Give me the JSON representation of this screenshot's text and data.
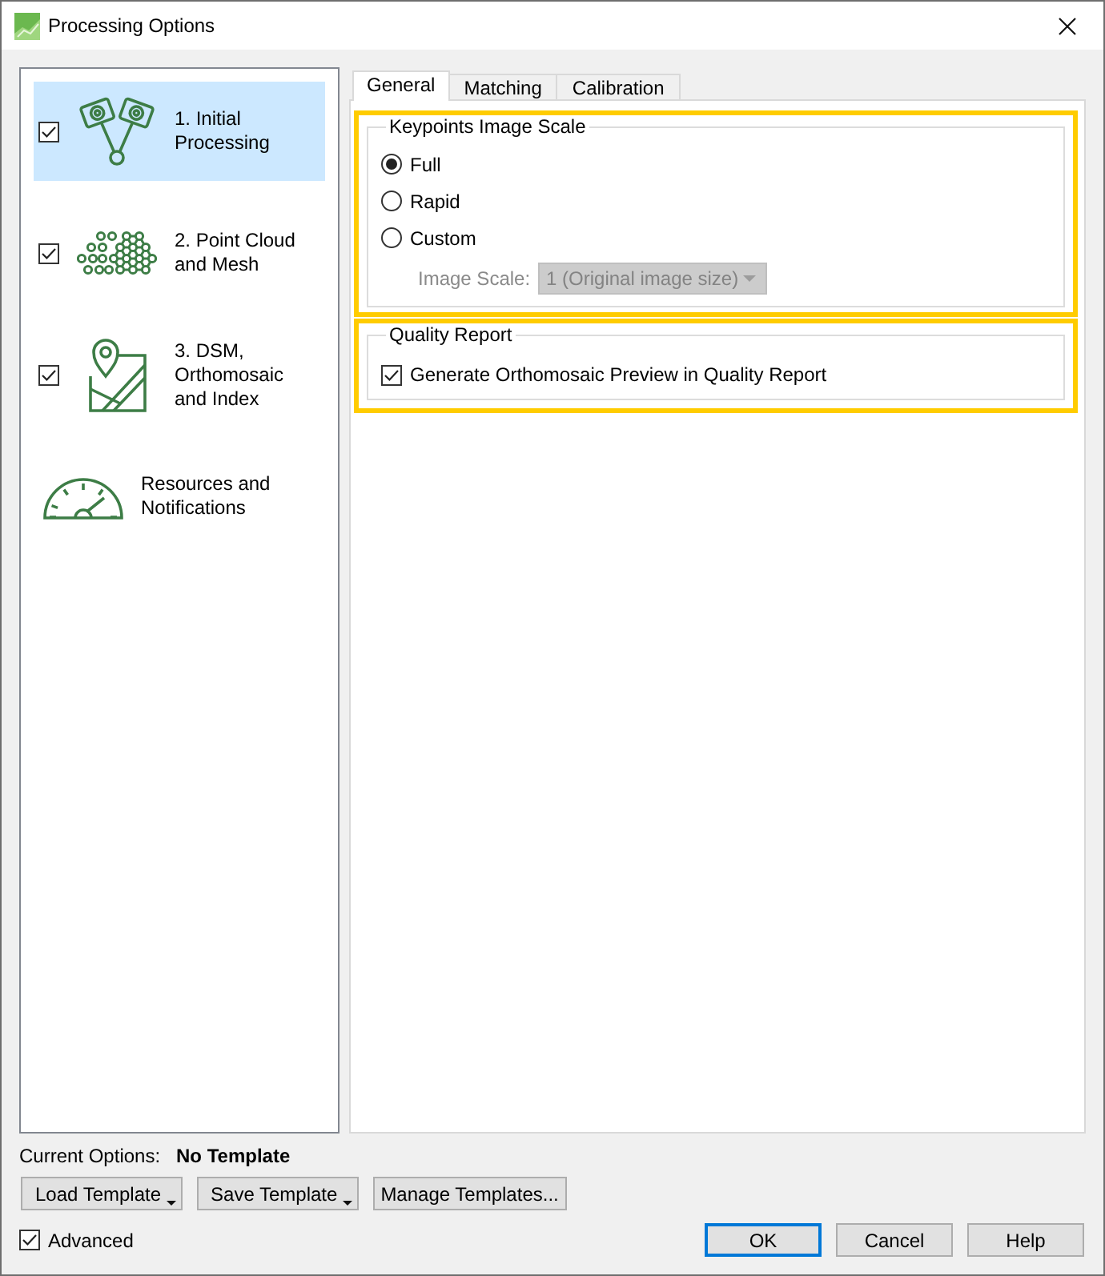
{
  "window": {
    "title": "Processing Options"
  },
  "sidebar": {
    "items": [
      {
        "kind": "step",
        "label": "1. Initial Processing",
        "checked": true,
        "selected": true
      },
      {
        "kind": "step",
        "label": "2. Point Cloud and Mesh",
        "checked": true,
        "selected": false
      },
      {
        "kind": "step",
        "label": "3. DSM, Orthomosaic and Index",
        "checked": true,
        "selected": false
      },
      {
        "kind": "page",
        "label": "Resources and Notifications",
        "selected": false
      }
    ]
  },
  "tabs": [
    {
      "label": "General",
      "selected": true
    },
    {
      "label": "Matching",
      "selected": false
    },
    {
      "label": "Calibration",
      "selected": false
    }
  ],
  "keypoints_image_scale": {
    "title": "Keypoints Image Scale",
    "highlighted": true,
    "options": [
      {
        "label": "Full",
        "selected": true
      },
      {
        "label": "Rapid",
        "selected": false
      },
      {
        "label": "Custom",
        "selected": false
      }
    ],
    "image_scale": {
      "label": "Image Scale:",
      "value": "1 (Original image size)",
      "disabled": true
    }
  },
  "quality_report": {
    "title": "Quality Report",
    "highlighted": true,
    "options": [
      {
        "label": "Generate Orthomosaic Preview in Quality Report",
        "checked": true
      }
    ]
  },
  "footer": {
    "current_options": {
      "label": "Current Options:",
      "value": "No Template"
    },
    "template_buttons": [
      {
        "label": "Load Template",
        "dropdown": true
      },
      {
        "label": "Save Template",
        "dropdown": true
      },
      {
        "label": "Manage Templates...",
        "dropdown": false
      }
    ],
    "advanced": {
      "label": "Advanced",
      "checked": true
    },
    "buttons": [
      {
        "label": "OK",
        "default": true
      },
      {
        "label": "Cancel",
        "default": false
      },
      {
        "label": "Help",
        "default": false
      }
    ]
  }
}
